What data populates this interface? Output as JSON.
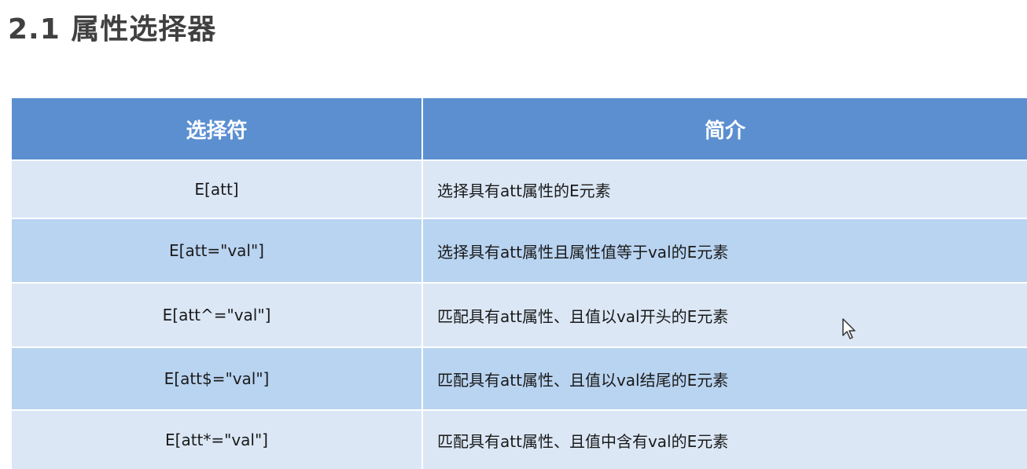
{
  "title": "2.1 属性选择器",
  "table": {
    "headers": [
      "选择符",
      "简介"
    ],
    "rows": [
      {
        "selector": "E[att]",
        "description": "选择具有att属性的E元素"
      },
      {
        "selector": "E[att=\"val\"]",
        "description": "选择具有att属性且属性值等于val的E元素"
      },
      {
        "selector": "E[att^=\"val\"]",
        "description": "匹配具有att属性、且值以val开头的E元素"
      },
      {
        "selector": "E[att$=\"val\"]",
        "description": "匹配具有att属性、且值以val结尾的E元素"
      },
      {
        "selector": "E[att*=\"val\"]",
        "description": "匹配具有att属性、且值中含有val的E元素"
      }
    ]
  },
  "colors": {
    "header_bg": "#5b8fd0",
    "row_light": "#dbe7f5",
    "row_dark": "#b9d4f1"
  },
  "icons": [
    "mouse-cursor-icon"
  ]
}
